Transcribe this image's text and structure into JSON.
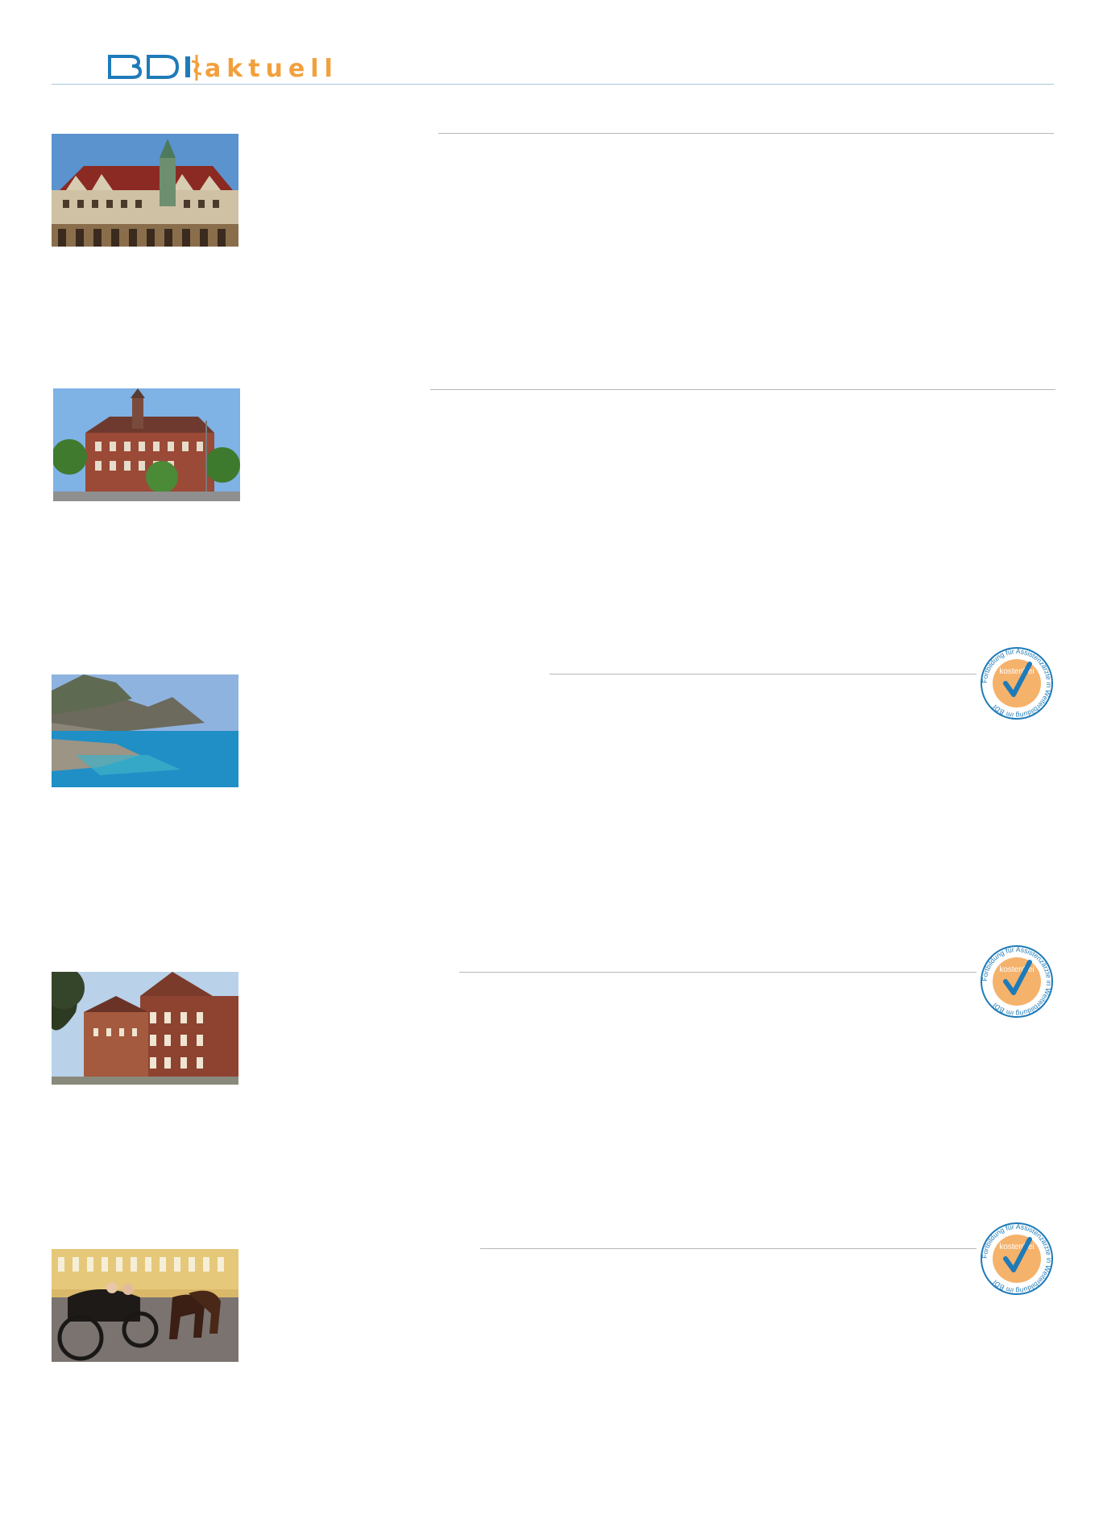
{
  "header": {
    "logo_text_primary": "BDI",
    "logo_text_secondary": "aktuell",
    "logo_color_primary": "#1f7bb8",
    "logo_color_secondary": "#f2a03d"
  },
  "entries": [
    {
      "image": "leipzig-old-town-hall-photo",
      "has_badge": false
    },
    {
      "image": "red-brick-building-with-tower-photo",
      "has_badge": false
    },
    {
      "image": "rocky-coast-and-sea-photo",
      "has_badge": true
    },
    {
      "image": "brick-hospital-building-photo",
      "has_badge": true
    },
    {
      "image": "horse-carriage-in-front-of-palace-photo",
      "has_badge": true
    }
  ],
  "badge": {
    "center_text": "kostenfrei",
    "ring_text": "Fortbildung für Assistenzärzte in Weiterbildung im BDI",
    "colors": {
      "ring": "#1f7bb8",
      "fill": "#f5b26b",
      "check": "#1f7bb8"
    }
  }
}
